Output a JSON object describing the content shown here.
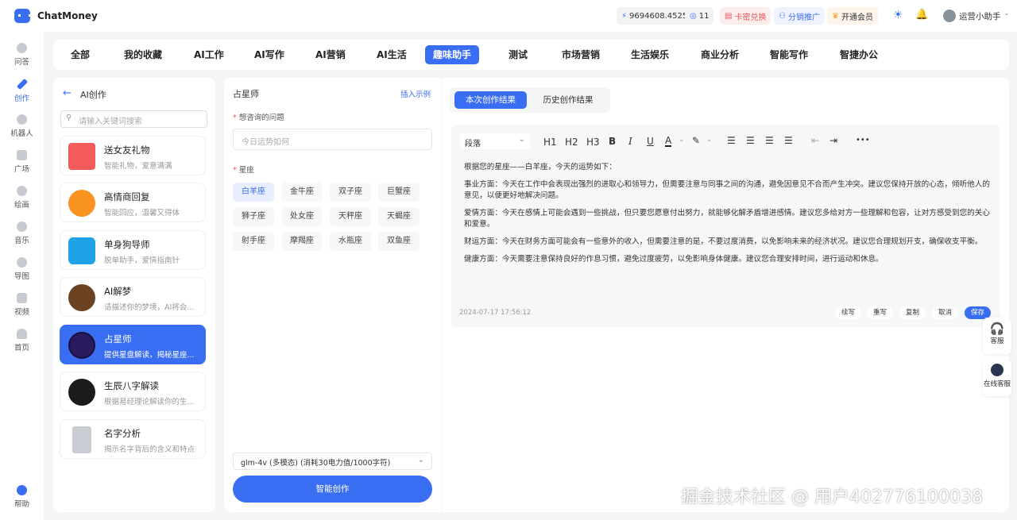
{
  "app": {
    "name": "ChatMoney"
  },
  "header": {
    "balance": "9694608.4525",
    "messages": "11",
    "card_redeem": "卡密兑换",
    "distribution": "分销推广",
    "vip": "开通会员",
    "username": "运营小助手"
  },
  "sidebar": {
    "items": [
      {
        "label": "问答"
      },
      {
        "label": "创作"
      },
      {
        "label": "机器人"
      },
      {
        "label": "广场"
      },
      {
        "label": "绘画"
      },
      {
        "label": "音乐"
      },
      {
        "label": "导图"
      },
      {
        "label": "视频"
      },
      {
        "label": "首页"
      }
    ],
    "help": "帮助",
    "active": "创作"
  },
  "tabs": [
    "全部",
    "我的收藏",
    "AI工作",
    "AI写作",
    "AI营销",
    "AI生活",
    "趣味助手",
    "测试",
    "市场营销",
    "生活娱乐",
    "商业分析",
    "智能写作",
    "智捷办公"
  ],
  "active_tab": "趣味助手",
  "left": {
    "title": "AI创作",
    "search_placeholder": "请输入关键词搜索",
    "cards": [
      {
        "title": "送女友礼物",
        "desc": "智能礼物，爱意满满"
      },
      {
        "title": "高情商回复",
        "desc": "智能回应，温馨又得体"
      },
      {
        "title": "单身狗导师",
        "desc": "脱单助手，爱情指南针"
      },
      {
        "title": "AI解梦",
        "desc": "请描述你的梦境，AI将会..."
      },
      {
        "title": "占星师",
        "desc": "提供星盘解读，揭秘星座..."
      },
      {
        "title": "生辰八字解读",
        "desc": "根据易经理论解读你的生..."
      },
      {
        "title": "名字分析",
        "desc": "揭示名字背后的含义和特点"
      }
    ],
    "active": "占星师"
  },
  "form": {
    "title": "占星师",
    "insert_example": "插入示例",
    "question_label": "想咨询的问题",
    "question_placeholder": "今日运势如何",
    "zodiac_label": "星座",
    "zodiacs": [
      "白羊座",
      "金牛座",
      "双子座",
      "巨蟹座",
      "狮子座",
      "处女座",
      "天秤座",
      "天蝎座",
      "射手座",
      "摩羯座",
      "水瓶座",
      "双鱼座"
    ],
    "selected_zodiac": "白羊座",
    "model": "glm-4v (多模态) (消耗30电力值/1000字符)",
    "submit": "智能创作"
  },
  "result": {
    "tabs": [
      "本次创作结果",
      "历史创作结果"
    ],
    "active_tab": "本次创作结果",
    "toolbar": {
      "paragraph": "段落",
      "h1": "H1",
      "h2": "H2",
      "h3": "H3",
      "bold": "B",
      "italic": "I",
      "underline": "U",
      "color": "A",
      "more": "•••"
    },
    "paragraphs": [
      "根据您的星座——白羊座，今天的运势如下：",
      "事业方面：今天在工作中会表现出强烈的进取心和领导力，但需要注意与同事之间的沟通，避免因意见不合而产生冲突。建议您保持开放的心态，倾听他人的意见，以便更好地解决问题。",
      "爱情方面：今天在感情上可能会遇到一些挑战，但只要您愿意付出努力，就能够化解矛盾增进感情。建议您多给对方一些理解和包容，让对方感受到您的关心和爱意。",
      "财运方面：今天在财务方面可能会有一些意外的收入，但需要注意的是，不要过度消费，以免影响未来的经济状况。建议您合理规划开支，确保收支平衡。",
      "健康方面：今天需要注意保持良好的作息习惯，避免过度疲劳，以免影响身体健康。建议您合理安排时间，进行运动和休息。"
    ],
    "timestamp": "2024-07-17 17:56:12",
    "actions": [
      "续写",
      "重写",
      "复制",
      "取消",
      "保存"
    ]
  },
  "float": {
    "service": "客服",
    "online_service": "在线客服"
  },
  "watermark": "掘金技术社区 @ 用户402776100038",
  "colors": {
    "accent": "#3a6ef2"
  }
}
